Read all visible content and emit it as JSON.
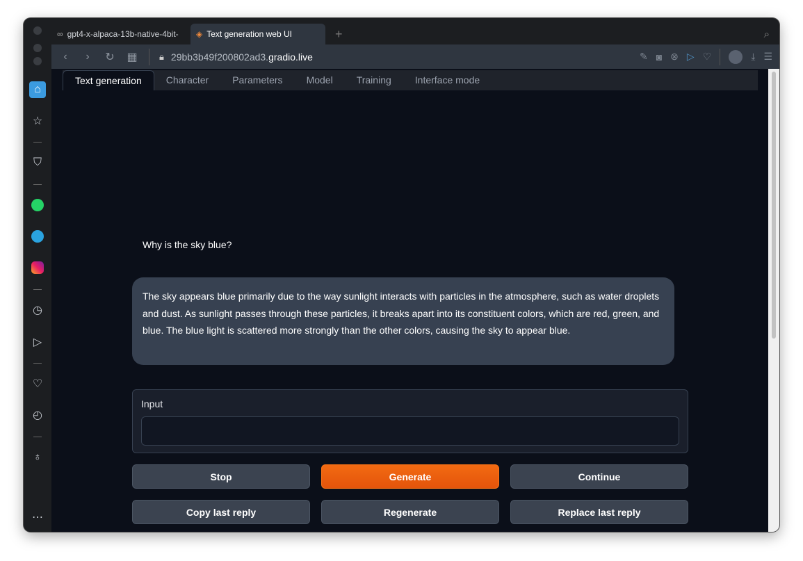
{
  "browser": {
    "tabs": [
      {
        "label": "gpt4-x-alpaca-13b-native-4bit-",
        "icon": "infinity-icon"
      },
      {
        "label": "Text generation web UI",
        "icon": "layers-icon"
      }
    ],
    "url_prefix": "29bb3b49f200802ad3.",
    "url_domain": "gradio.live"
  },
  "app": {
    "tabs": [
      "Text generation",
      "Character",
      "Parameters",
      "Model",
      "Training",
      "Interface mode"
    ]
  },
  "chat": {
    "user_message": "Why is the sky blue?",
    "bot_message": "The sky appears blue primarily due to the way sunlight interacts with particles in the atmosphere, such as water droplets and dust. As sunlight passes through these particles, it breaks apart into its constituent colors, which are red, green, and blue. The blue light is scattered more strongly than the other colors, causing the sky to appear blue."
  },
  "input": {
    "label": "Input",
    "value": ""
  },
  "buttons": {
    "stop": "Stop",
    "generate": "Generate",
    "continue": "Continue",
    "copy": "Copy last reply",
    "regenerate": "Regenerate",
    "replace": "Replace last reply"
  },
  "colors": {
    "accent": "#f26a12",
    "background": "#0b0f19",
    "bubble": "#374151"
  }
}
